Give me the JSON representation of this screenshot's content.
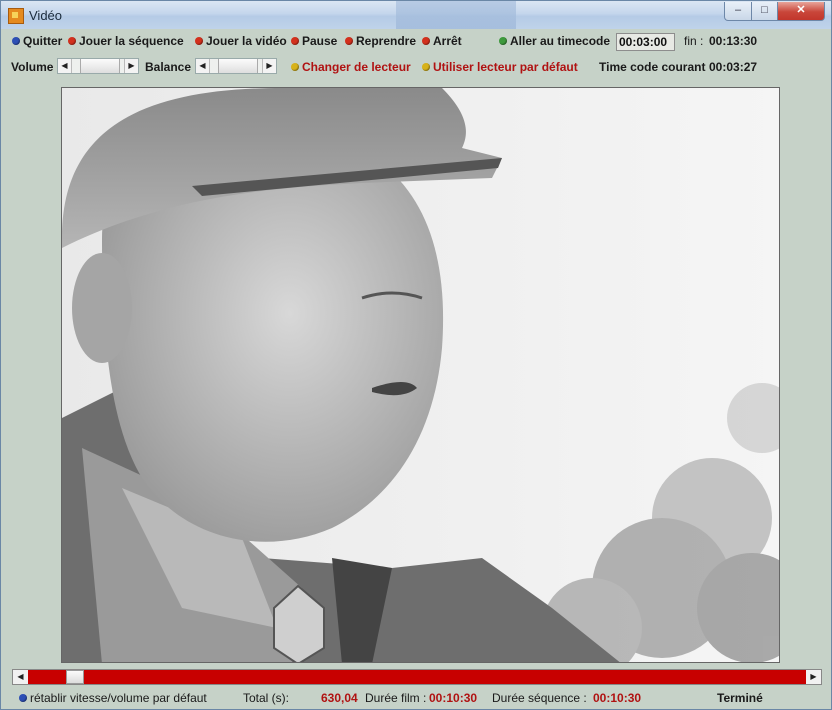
{
  "window": {
    "title": "Vidéo",
    "minimize": "–",
    "maximize": "□",
    "close": "✕"
  },
  "toolbar": {
    "quit": "Quitter",
    "play_sequence": "Jouer la séquence",
    "play_video": "Jouer la vidéo",
    "pause": "Pause",
    "resume": "Reprendre",
    "stop": "Arrêt",
    "goto_timecode": "Aller au timecode",
    "timecode_value": "00:03:00",
    "end_label": "fin",
    "end_sep": ":",
    "end_value": "00:13:30"
  },
  "toolbar2": {
    "volume_label": "Volume",
    "balance_label": "Balance",
    "change_player": "Changer de lecteur",
    "default_player": "Utiliser lecteur par défaut",
    "current_tc_label": "Time code courant",
    "current_tc_value": "00:03:27"
  },
  "status": {
    "reset": "rétablir vitesse/volume par défaut",
    "total_label": "Total (s):",
    "total_value": "630,04",
    "film_label": "Durée film :",
    "film_value": "00:10:30",
    "seq_label": "Durée séquence :",
    "seq_value": "00:10:30",
    "state": "Terminé"
  },
  "playback": {
    "position_fraction": 0.05
  },
  "colors": {
    "seek": "#c80000",
    "value_red": "#b01212",
    "window_bg": "#c6d2c8"
  },
  "icons": {
    "arrow_left": "◀",
    "arrow_right": "▶"
  }
}
